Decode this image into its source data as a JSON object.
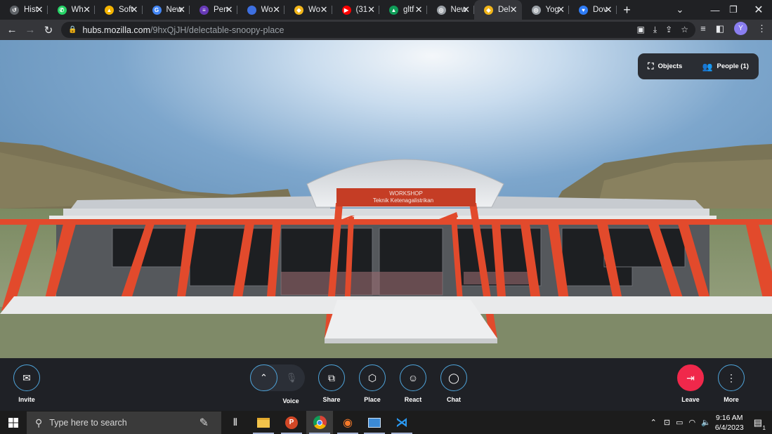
{
  "browser": {
    "tabs": [
      {
        "title": "Hist",
        "icon": "history-icon",
        "color": "#5f6368",
        "glyph": "↺"
      },
      {
        "title": "Wh",
        "icon": "whatsapp-icon",
        "color": "#25d366",
        "glyph": "✆"
      },
      {
        "title": "Soft",
        "icon": "google-drive-icon",
        "color": "#f4b400",
        "glyph": "▲"
      },
      {
        "title": "New",
        "icon": "new-tab-icon",
        "color": "#4285f4",
        "glyph": "G"
      },
      {
        "title": "Pen",
        "icon": "forms-icon",
        "color": "#673ab7",
        "glyph": "≡"
      },
      {
        "title": "Wo",
        "icon": "circle-icon",
        "color": "#3d6fe0",
        "glyph": ""
      },
      {
        "title": "Wo",
        "icon": "duck-icon",
        "color": "#f2b619",
        "glyph": "◆"
      },
      {
        "title": "(31",
        "icon": "youtube-icon",
        "color": "#ff0000",
        "glyph": "▶"
      },
      {
        "title": "gltf",
        "icon": "google-drive-icon",
        "color": "#0f9d58",
        "glyph": "▲"
      },
      {
        "title": "New",
        "icon": "chrome-icon",
        "color": "#9aa0a6",
        "glyph": "◎"
      },
      {
        "title": "Del",
        "icon": "duck-icon",
        "color": "#f2b619",
        "glyph": "◆",
        "active": true
      },
      {
        "title": "Yog",
        "icon": "globe-icon",
        "color": "#9aa0a6",
        "glyph": "◎"
      },
      {
        "title": "Dov",
        "icon": "heart-icon",
        "color": "#2f7cf6",
        "glyph": "♥"
      }
    ],
    "url_host": "hubs.mozilla.com",
    "url_path": "/9hxQjJH/delectable-snoopy-place",
    "profile_initial": "Y"
  },
  "scene": {
    "sign_line1": "WORKSHOP",
    "sign_line2": "Teknik Ketenagalistrikan",
    "panel": {
      "objects_label": "Objects",
      "people_label": "People (1)"
    }
  },
  "bottombar": {
    "invite": "Invite",
    "voice": "Voice",
    "share": "Share",
    "place": "Place",
    "react": "React",
    "chat": "Chat",
    "leave": "Leave",
    "more": "More"
  },
  "taskbar": {
    "search_placeholder": "Type here to search",
    "time": "9:16 AM",
    "date": "6/4/2023",
    "notification_count": "1"
  }
}
